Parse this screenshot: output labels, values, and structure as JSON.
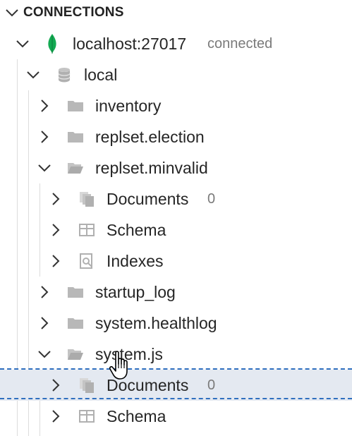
{
  "section": {
    "title": "CONNECTIONS"
  },
  "connection": {
    "name": "localhost:27017",
    "status": "connected",
    "icon": "mongodb-leaf-icon",
    "accent": "#13aa52"
  },
  "database": {
    "name": "local",
    "icon": "database-icon"
  },
  "collections": [
    {
      "name": "inventory",
      "expanded": false
    },
    {
      "name": "replset.election",
      "expanded": false
    },
    {
      "name": "replset.minvalid",
      "expanded": true,
      "children": [
        {
          "label": "Documents",
          "count": "0",
          "icon": "documents-icon"
        },
        {
          "label": "Schema",
          "icon": "schema-icon"
        },
        {
          "label": "Indexes",
          "icon": "indexes-icon"
        }
      ]
    },
    {
      "name": "startup_log",
      "expanded": false
    },
    {
      "name": "system.healthlog",
      "expanded": false
    },
    {
      "name": "system.js",
      "expanded": true,
      "children": [
        {
          "label": "Documents",
          "count": "0",
          "icon": "documents-icon",
          "selected": true
        },
        {
          "label": "Schema",
          "icon": "schema-icon"
        }
      ]
    }
  ],
  "colors": {
    "selection": "#e4e9f1",
    "focus_outline": "#2f6fbf",
    "muted_text": "#7a7a7a"
  }
}
